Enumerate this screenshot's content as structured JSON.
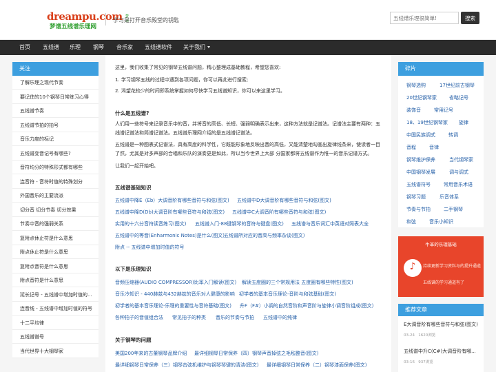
{
  "header": {
    "logo_text": "dreampu.com",
    "logo_tag": "梦谱",
    "logo_subtitle": "梦谱五线谱乐理网",
    "slogan": "学习是打开音乐殿堂的钥匙",
    "search_placeholder": "五线谱乐理很简单!",
    "search_button": "搜索"
  },
  "nav": {
    "items": [
      "首页",
      "五线谱",
      "乐理",
      "钢琴",
      "音乐家",
      "五线谱软件",
      "关于我们"
    ]
  },
  "left_sidebar": {
    "title": "关注",
    "items": [
      "了解乐理之现代节奏",
      "要记住的10个钢琴日常练习心得",
      "五线谱节奏",
      "五线谱节拍的拍号",
      "音乐力度的标记",
      "五线谱变音记号有哪些?",
      "音符均分的特殊形式都有哪些",
      "连音符 - 音符时值的特殊划分",
      "外国音乐的主要流派",
      "切分音 切分节奏 切分效果",
      "节奏中音的强弱关系",
      "复附点休止符是什么意思",
      "附点休止符是什么意思",
      "复附点音符是什么意思",
      "附点音符是什么意思",
      "延长记号 - 五线谱中增加时值的...",
      "连音线 - 五线谱中增加时值的符号",
      "十二平均律",
      "五线谱谱号",
      "当代世界十大钢琴家"
    ]
  },
  "content": {
    "intro": "这里，我们收集了常见的钢琴五线谱问题，精心整理成基础教程，希望您喜欢:",
    "points": [
      "1. 学习钢琴五线的过程中遇到各项问题，你可以再此进行搜索;",
      "2. 渴望花较少的时间即系统掌握如何尽快学习五线谱知识，你可以来这里学习。"
    ],
    "what_title": "什么是五线谱?",
    "what_lines": [
      "人们用一些符号来记录音乐中的音，并将音的高低、长短、强弱明确表示出来，这种方法就是记谱法。记谱法主要有两种：五",
      "线谱记谱法和简谱记谱法。五线谱乐理网介绍的是五线谱记谱法。",
      "五线谱是一种图表式记谱法，具有高度的科学性，它既能形象地反映出音的高低，又能清楚地勾画出旋律线条来，使读者一目",
      "了然，尤其是对多声部的合唱和乐队的演奏更是如此，所以当今世界上大部 分国家都将五线谱作为惟一的音乐记谱方式。"
    ],
    "start": "让我们一起开始吧。",
    "basics_title": "五线谱基础知识",
    "basics_links": [
      [
        "五线谱中降E（Eb）大调音阶有哪些音符与和弦(图文)",
        "五线谱中D大调音阶有哪些音符与和弦(图文)"
      ],
      [
        "五线谱中降D(Db)大调音阶有哪些音符与和弦(图文)",
        "五线谱中C大调音阶有哪些音符与和弦(图文)"
      ],
      [
        "实用的十六分音符读音练习(图文)",
        "五线谱入门-88键钢琴的音符与键盘(图文)",
        "五线谱与音乐词汇中英语对照表大全"
      ],
      [
        "五线谱中的等音(Enharmonic Notes)是什么(图文)",
        "五线谱所对应的音高与频率杂谈(图文)"
      ],
      [
        "附点 -- 五线谱中增加时值的符号"
      ]
    ],
    "theory_title": "以下是乐理知识",
    "theory_links": [
      [
        "音频压缩器(AUDIO COMPRESSOR)比率入门解读(图文)",
        "解读五度圈的三个常规用法 五度圈有哪些特性(图文)"
      ],
      [
        "音乐冷知识 - 440赫兹与432赫兹的音乐对人健康的影响",
        "初学者的基本音乐理论-音阶与和弦基础(图文)"
      ],
      [
        "初学者的基本音乐理论-乐理的重要性与音符基础(图文)",
        "升F（F#）小调的自然音阶和声音阶与旋律小调音阶组成(图文)"
      ],
      [
        "各种拍子的音值组合法",
        "常见拍子的种类",
        "音乐的节奏与节拍",
        "五线谱中的纯律"
      ]
    ],
    "piano_title": "关于钢琴的问题",
    "piano_links": [
      [
        "美国200年来的古董钢琴品牌介绍",
        "最详细钢琴日常保养（四）钢琴声音掉弦之毛毡整音(图文)"
      ],
      [
        "最详细钢琴日常保养（三）钢琴击弦机维护与钢琴琴键的清洁(图文)",
        "最详细钢琴日常保养（二）钢琴漆面保养(图文)"
      ]
    ]
  },
  "right_sidebar": {
    "title": "碎片",
    "tags": [
      [
        "钢琴选购",
        "17世纪前古钢琴"
      ],
      [
        "20世纪钢琴家",
        "省略记号"
      ],
      [
        "装饰音",
        "常用记号"
      ],
      [
        "18、19世纪钢琴家",
        "旋律"
      ],
      [
        "中国民族调式",
        "转调"
      ],
      [
        "音程",
        "音律"
      ],
      [
        "钢琴维护保养",
        "当代钢琴家"
      ],
      [
        "中国钢琴发展",
        "调与调式"
      ],
      [
        "五线谱符号",
        "常用音乐术语"
      ],
      [
        "钢琴习题",
        "乐音体系"
      ],
      [
        "节奏与节拍",
        "二手钢琴"
      ],
      [
        "和弦",
        "音乐小知识"
      ]
    ],
    "promo_title": "牛革的乐理基础",
    "promo_lines": [
      "持续更新学习资料与的提升通道",
      "五线谱的学习通道有了"
    ],
    "recommend_title": "推荐文章",
    "recommend": [
      {
        "title": "E大调音阶有哪些音符与和弦(图文)",
        "date": "03-24",
        "views": "1620浏览"
      },
      {
        "title": "五线谱中升C(C#)大调音阶有哪...",
        "date": "03-16",
        "views": "937浏览"
      }
    ]
  },
  "colors": {
    "accent": "#3d9fdf",
    "nav_bg": "#2b2b2b",
    "link": "#2660a8",
    "promo": "#e8452b",
    "logo_red": "#d9401b",
    "logo_green": "#2f9e2f"
  }
}
